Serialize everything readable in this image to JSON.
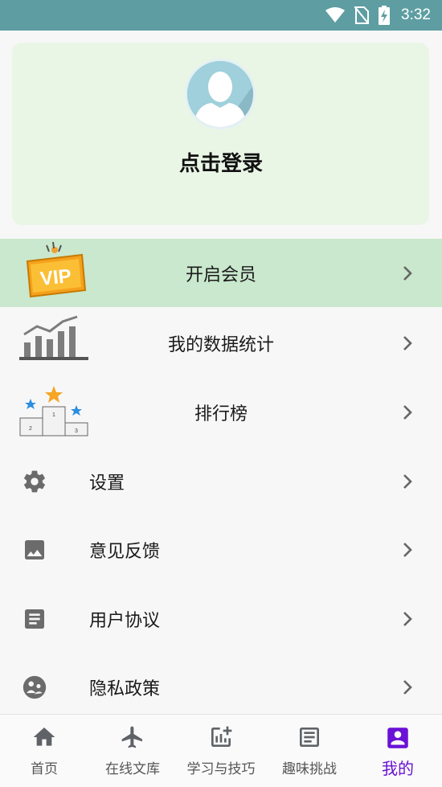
{
  "status_bar": {
    "time": "3:32",
    "icons": [
      "wifi-icon",
      "no-sim-icon",
      "battery-charging-icon"
    ]
  },
  "profile": {
    "login_text": "点击登录",
    "avatar_icon": "default-avatar-icon"
  },
  "menu": {
    "vip": {
      "label": "开启会员",
      "icon": "vip-badge-icon",
      "badge_text": "VIP"
    },
    "stats": {
      "label": "我的数据统计",
      "icon": "bar-chart-icon"
    },
    "ranking": {
      "label": "排行榜",
      "icon": "podium-icon",
      "places": [
        "2",
        "1",
        "3"
      ]
    },
    "settings": {
      "label": "设置",
      "icon": "gear-icon"
    },
    "feedback": {
      "label": "意见反馈",
      "icon": "image-icon"
    },
    "agreement": {
      "label": "用户协议",
      "icon": "document-icon"
    },
    "privacy": {
      "label": "隐私政策",
      "icon": "privacy-icon"
    }
  },
  "bottom_nav": [
    {
      "label": "首页",
      "icon": "home-icon"
    },
    {
      "label": "在线文库",
      "icon": "airplane-icon"
    },
    {
      "label": "学习与技巧",
      "icon": "chart-add-icon"
    },
    {
      "label": "趣味挑战",
      "icon": "article-icon"
    },
    {
      "label": "我的",
      "icon": "account-box-icon",
      "active": true
    }
  ],
  "colors": {
    "status_bar": "#5e9ea2",
    "profile_card": "#e9f6e6",
    "vip_row": "#c9e8cd",
    "nav_active": "#6a11d6",
    "icon_gray": "#6b6b6b"
  }
}
